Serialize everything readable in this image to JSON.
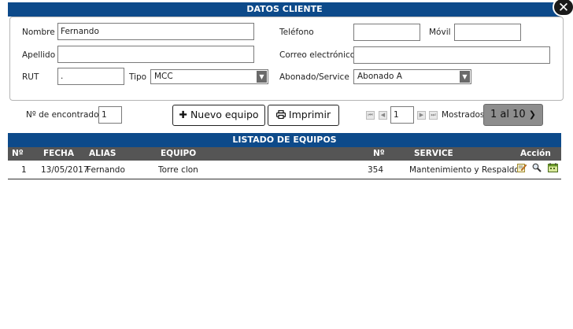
{
  "client_header": "DATOS CLIENTE",
  "close_glyph": "✕",
  "form": {
    "nombre_label": "Nombre",
    "nombre_value": "Fernando",
    "apellido_label": "Apellido",
    "apellido_value": "",
    "rut_label": "RUT",
    "rut_value": ".",
    "tipo_label": "Tipo",
    "tipo_value": "MCC",
    "telefono_label": "Teléfono",
    "telefono_value": "",
    "movil_label": "Móvil",
    "movil_value": "",
    "correo_label": "Correo electrónico",
    "correo_value": "",
    "abonado_label": "Abonado/Service",
    "abonado_value": "Abonado A"
  },
  "toolbar": {
    "encontrados_label": "Nº de encontrados",
    "encontrados_value": "1",
    "nuevo_equipo_label": "Nuevo equipo",
    "imprimir_label": "Imprimir",
    "page_value": "1",
    "mostrados_label": "Mostrados",
    "range_label": "1 al 10"
  },
  "list_header": "LISTADO DE EQUIPOS",
  "columns": [
    "Nº",
    "FECHA",
    "ALIAS",
    "EQUIPO",
    "Nº",
    "SERVICE",
    "Acción"
  ],
  "rows": [
    {
      "num": "1",
      "fecha": "13/05/2017",
      "alias": "Fernando",
      "equipo": "Torre clon",
      "numero": "354",
      "service": "Mantenimiento y Respaldos",
      "actions": [
        "edit-icon",
        "search-icon",
        "calendar-icon"
      ]
    }
  ],
  "colors": {
    "header_blue": "#0d4a8a",
    "table_header_gray": "#555555"
  }
}
